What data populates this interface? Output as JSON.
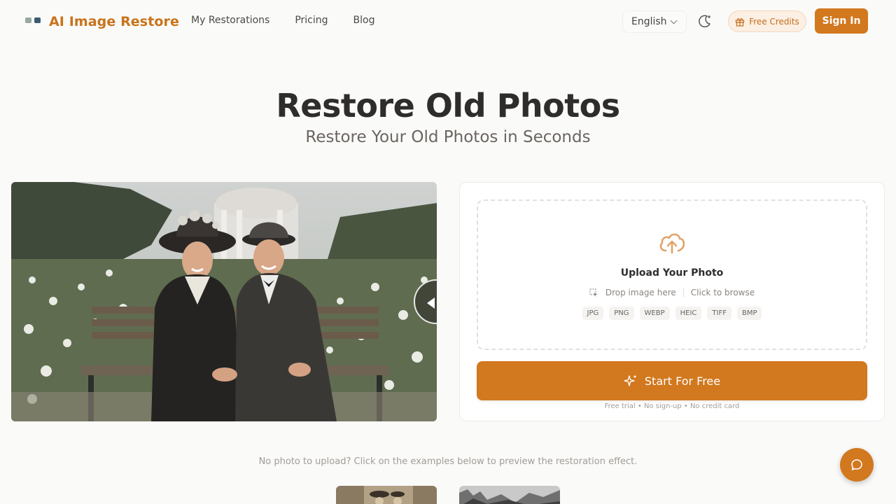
{
  "header": {
    "logo_text": "AI Image Restore",
    "nav": [
      {
        "label": "My Restorations"
      },
      {
        "label": "Pricing"
      },
      {
        "label": "Blog"
      }
    ],
    "language": "English",
    "theme_icon": "moon-sparkle-icon",
    "credits_label": "Free Credits",
    "signin_label": "Sign In"
  },
  "hero": {
    "title": "Restore Old Photos",
    "subtitle": "Restore Your Old Photos in Seconds"
  },
  "upload": {
    "title": "Upload Your Photo",
    "drop_hint": "Drop image here",
    "browse_hint": "Click to browse",
    "formats": [
      "JPG",
      "PNG",
      "WEBP",
      "HEIC",
      "TIFF",
      "BMP"
    ],
    "button_label": "Start For Free",
    "note": "Free trial • No sign-up • No credit card"
  },
  "examples": {
    "note": "No photo to upload? Click on the examples below to preview the restoration effect."
  },
  "colors": {
    "accent": "#d2781e",
    "logo": "#c9731b"
  }
}
